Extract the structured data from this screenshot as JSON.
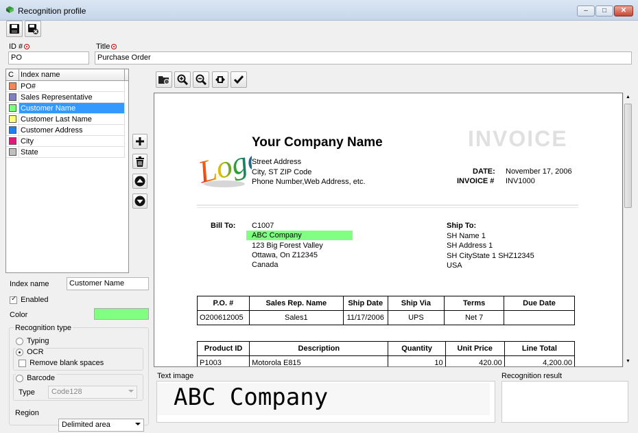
{
  "window": {
    "title": "Recognition profile",
    "min": "–",
    "max": "□",
    "close": "✕"
  },
  "fields": {
    "id_label": "ID #",
    "id_value": "PO",
    "title_label": "Title",
    "title_value": "Purchase Order"
  },
  "grid": {
    "col_c": "C",
    "col_name": "Index name",
    "rows": [
      {
        "label": "PO#",
        "color": "#f2875a"
      },
      {
        "label": "Sales Representative",
        "color": "#8080c0"
      },
      {
        "label": "Customer Name",
        "color": "#80ff80",
        "selected": true
      },
      {
        "label": "Customer Last Name",
        "color": "#ffff80"
      },
      {
        "label": "Customer Address",
        "color": "#1e7ff0"
      },
      {
        "label": "City",
        "color": "#e0187a"
      },
      {
        "label": "State",
        "color": "#c0c0c0"
      }
    ]
  },
  "props": {
    "index_name_label": "Index name",
    "index_name_value": "Customer Name",
    "enabled_label": "Enabled",
    "color_label": "Color",
    "color_value": "#80ff80",
    "recognition_type_label": "Recognition type",
    "typing_label": "Typing",
    "ocr_label": "OCR",
    "remove_blank_label": "Remove blank spaces",
    "barcode_label": "Barcode",
    "type_label": "Type",
    "type_value": "Code128",
    "region_label": "Region",
    "region_value": "Delimited area"
  },
  "invoice": {
    "company": "Your Company Name",
    "heading": "INVOICE",
    "logo_text": "Logo",
    "address1": "Street Address",
    "address2": "City, ST  ZIP Code",
    "address3": "Phone Number,Web Address, etc.",
    "date_label": "DATE:",
    "date_value": "November 17, 2006",
    "invoice_label": "INVOICE #",
    "invoice_value": "INV1000",
    "bill_to_label": "Bill To:",
    "bill_to": [
      "C1007",
      "ABC Company",
      "123 Big Forest Valley",
      "Ottawa, On Z12345",
      "Canada"
    ],
    "ship_to_label": "Ship To:",
    "ship_to": [
      "SH Name 1",
      "SH Address 1",
      "SH CityState 1 SHZ12345",
      "USA"
    ],
    "t1_headers": [
      "P.O. #",
      "Sales Rep. Name",
      "Ship Date",
      "Ship Via",
      "Terms",
      "Due Date"
    ],
    "t1_row": [
      "O200612005",
      "Sales1",
      "11/17/2006",
      "UPS",
      "Net 7",
      ""
    ],
    "t2_headers": [
      "Product ID",
      "Description",
      "Quantity",
      "Unit Price",
      "Line Total"
    ],
    "t2_row": [
      "P1003",
      "Motorola E815",
      "10",
      "420.00",
      "4,200.00"
    ]
  },
  "bottom": {
    "text_image_label": "Text image",
    "text_image_value": "ABC Company",
    "recognition_result_label": "Recognition result"
  }
}
